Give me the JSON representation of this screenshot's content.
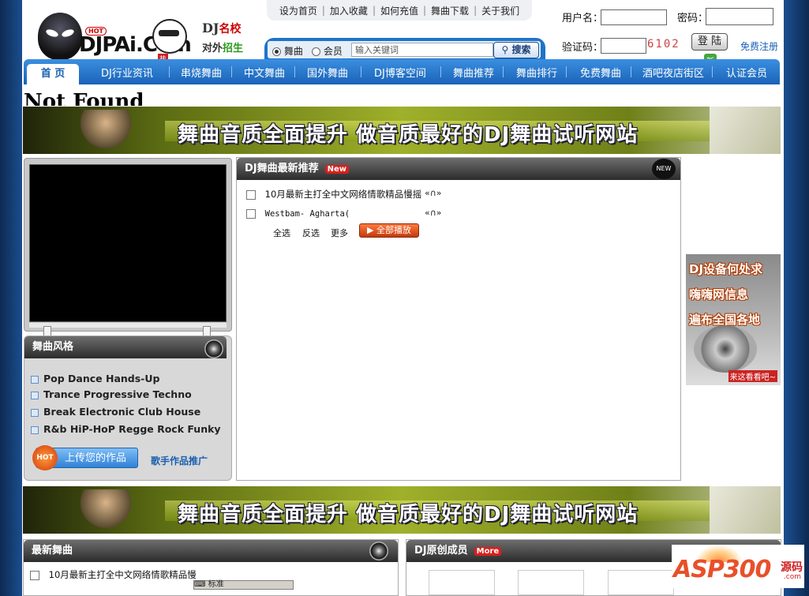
{
  "top_nav": [
    "设为首页",
    "加入收藏",
    "如何充值",
    "舞曲下载",
    "关于我们"
  ],
  "logo": {
    "text": "DJPAi.Com",
    "hot": "HOT",
    "hot_mark": "热"
  },
  "ad_school": {
    "line1": "DJ",
    "line1_red": "名校",
    "line2": "对外",
    "line2_green": "招生"
  },
  "search": {
    "option1": "舞曲",
    "option2": "会员",
    "placeholder": "输入关键词",
    "button": "搜索"
  },
  "login": {
    "username_label": "用户名：",
    "password_label": "密码：",
    "captcha_label": "验证码：",
    "captcha": "6102",
    "login_button": "登 陆",
    "register": "免费注册"
  },
  "main_nav": {
    "home": "首 页",
    "items": [
      "DJ行业资讯",
      "串烧舞曲",
      "中文舞曲",
      "国外舞曲",
      "DJ博客空间",
      "舞曲推荐",
      "舞曲排行",
      "免费舞曲",
      "酒吧夜店街区",
      "认证会员"
    ],
    "new_badge": "新"
  },
  "not_found": "Not Found",
  "banner_text": "舞曲音质全面提升 做音质最好的DJ舞曲试听网站",
  "styles_box": {
    "title": "舞曲风格",
    "items": [
      "Pop Dance Hands-Up",
      "Trance Progressive Techno",
      "Break Electronic Club House",
      "R&b HiP-HoP Regge Rock Funky"
    ],
    "upload_hot": "HOT",
    "upload": "上传您的作品",
    "singer_promo": "歌手作品推广"
  },
  "recommend": {
    "title": "DJ舞曲最新推荐",
    "new_tag": "New",
    "icon_text": "NEW",
    "songs": [
      "10月最新主打全中文网络情歌精品慢摇",
      "Westbam- Agharta("
    ],
    "controls": {
      "select_all": "全选",
      "invert": "反选",
      "more": "更多",
      "play_all": "全部播放"
    }
  },
  "side_ad": {
    "lines": [
      "DJ设备何处求",
      "嗨嗨网信息",
      "遍布全国各地"
    ],
    "cta": "来这看看吧~"
  },
  "latest": {
    "title": "最新舞曲",
    "first_song": "10月最新主打全中文网络情歌精品慢"
  },
  "members": {
    "title": "DJ原创成员",
    "more_tag": "More"
  },
  "watermark": {
    "big": "ASP300",
    "cn": "源码",
    "com": ".com"
  },
  "taskbar": {
    "label": "标准"
  }
}
